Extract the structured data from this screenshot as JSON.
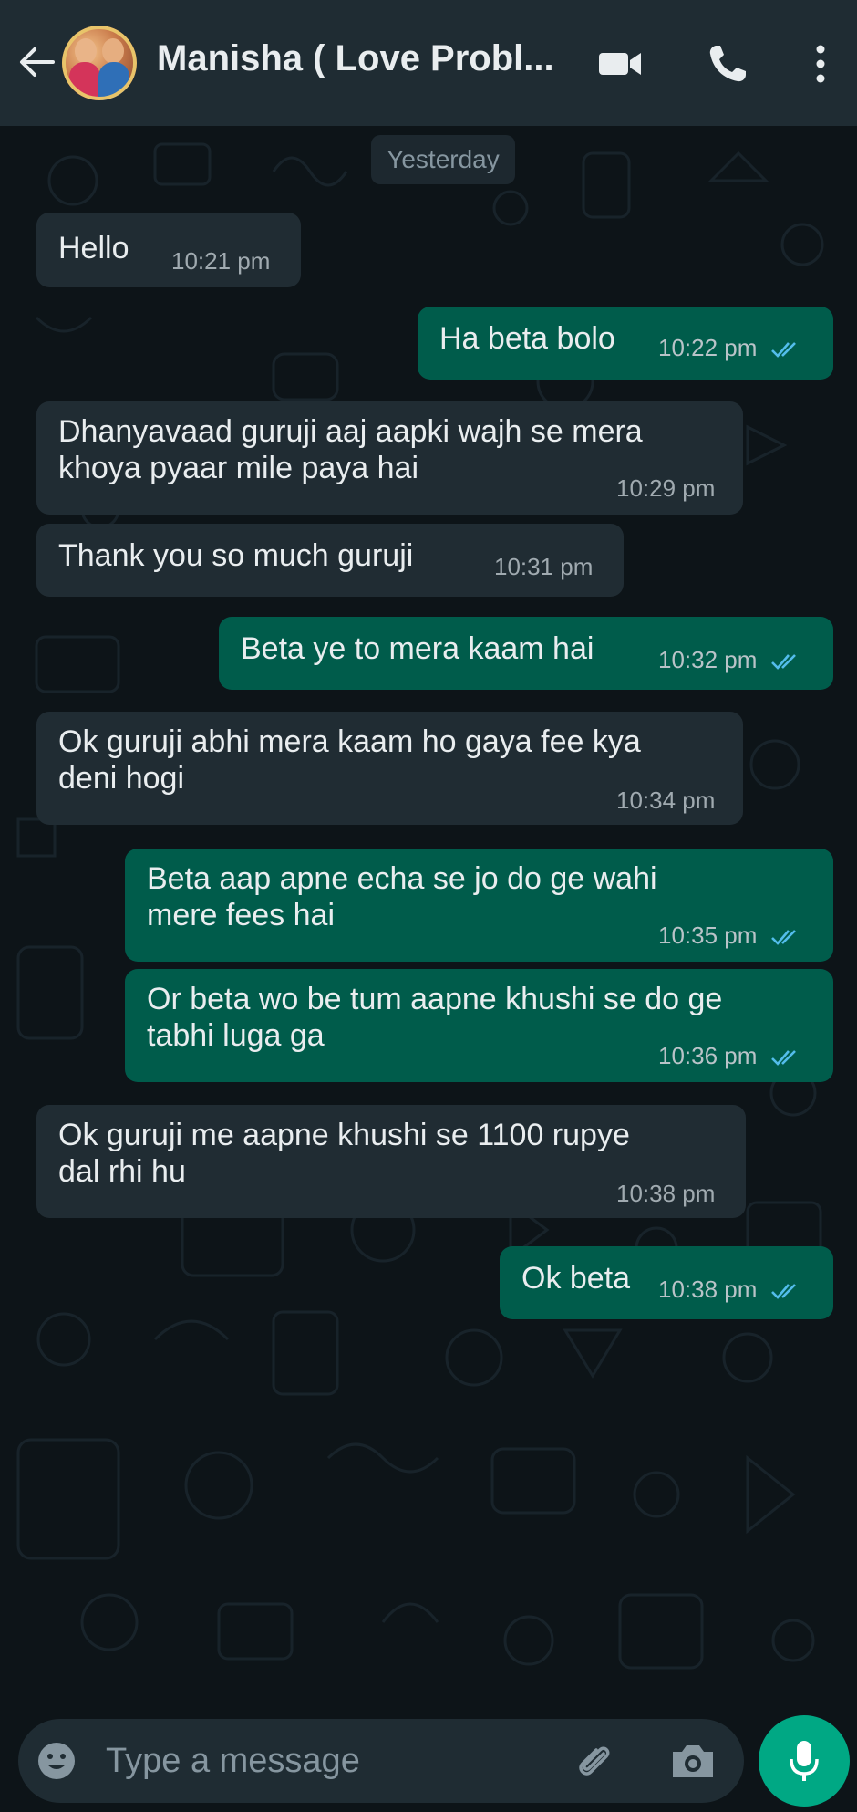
{
  "header": {
    "contact_name": "Manisha ( Love Probl...",
    "back_icon": "arrow-left-icon",
    "video_icon": "video-camera-icon",
    "call_icon": "phone-icon",
    "menu_icon": "more-vertical-icon"
  },
  "chat": {
    "date_label": "Yesterday",
    "messages": [
      {
        "direction": "in",
        "lines": [
          "Hello"
        ],
        "time": "10:21 pm"
      },
      {
        "direction": "out",
        "lines": [
          "Ha beta bolo"
        ],
        "time": "10:22 pm",
        "read": true
      },
      {
        "direction": "in",
        "lines": [
          "Dhanyavaad guruji aaj aapki wajh se mera",
          "khoya pyaar mile paya hai"
        ],
        "time": "10:29 pm"
      },
      {
        "direction": "in",
        "lines": [
          "Thank you so much guruji"
        ],
        "time": "10:31 pm"
      },
      {
        "direction": "out",
        "lines": [
          "Beta ye to mera kaam hai"
        ],
        "time": "10:32 pm",
        "read": true
      },
      {
        "direction": "in",
        "lines": [
          "Ok guruji abhi mera kaam ho gaya fee kya",
          "deni hogi"
        ],
        "time": "10:34 pm"
      },
      {
        "direction": "out",
        "lines": [
          "Beta aap apne echa se jo do ge wahi",
          "mere fees hai"
        ],
        "time": "10:35 pm",
        "read": true
      },
      {
        "direction": "out",
        "lines": [
          "Or beta wo be  tum aapne khushi se do ge",
          "tabhi luga ga"
        ],
        "time": "10:36 pm",
        "read": true
      },
      {
        "direction": "in",
        "lines": [
          "Ok guruji me aapne khushi se  1100 rupye",
          "dal rhi hu"
        ],
        "time": "10:38 pm"
      },
      {
        "direction": "out",
        "lines": [
          "Ok beta"
        ],
        "time": "10:38 pm",
        "read": true
      }
    ]
  },
  "composer": {
    "placeholder": "Type a message",
    "value": "",
    "emoji_icon": "emoji-icon",
    "attach_icon": "paperclip-icon",
    "camera_icon": "camera-icon",
    "mic_icon": "microphone-icon"
  },
  "colors": {
    "header_bg": "#1f2c33",
    "chat_bg": "#0d1418",
    "incoming_bubble": "#202c33",
    "outgoing_bubble": "#005c4b",
    "read_ticks": "#53bdeb",
    "accent": "#00a884"
  }
}
